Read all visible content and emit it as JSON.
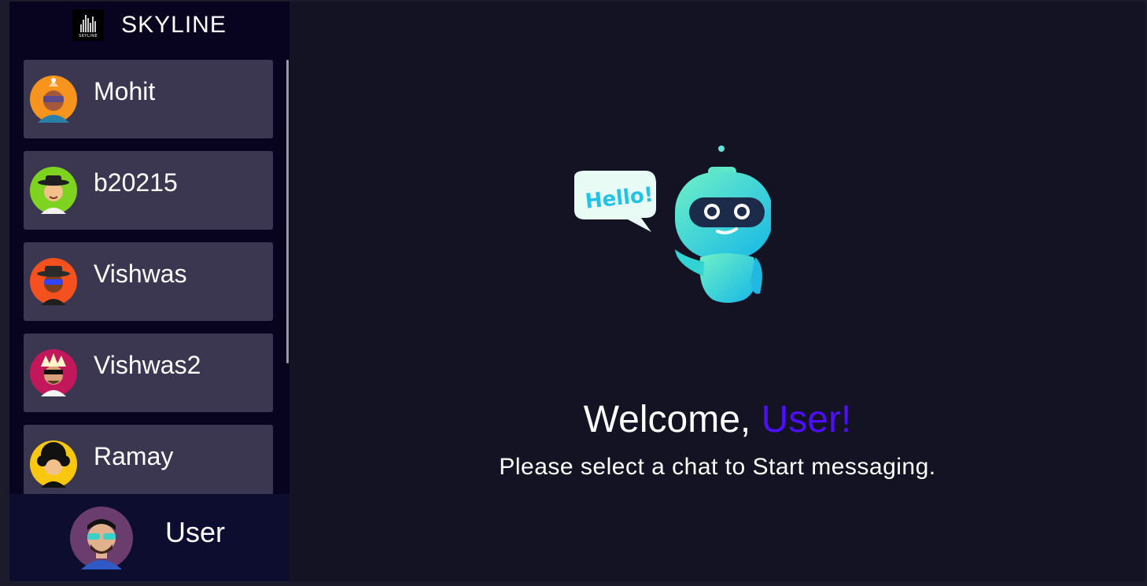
{
  "brand": {
    "name": "SKYLINE",
    "logo_text": "SKYLINE"
  },
  "contacts": [
    {
      "name": "Mohit",
      "avatar_bg": "#f7941d"
    },
    {
      "name": "b20215",
      "avatar_bg": "#7ed321"
    },
    {
      "name": "Vishwas",
      "avatar_bg": "#f4511e"
    },
    {
      "name": "Vishwas2",
      "avatar_bg": "#c2185b"
    },
    {
      "name": "Ramay",
      "avatar_bg": "#f9c80e"
    }
  ],
  "current_user": {
    "name": "User",
    "avatar_bg": "#6a3d6e"
  },
  "welcome": {
    "greeting": "Welcome, ",
    "username": "User!",
    "subtitle": "Please select a chat to Start messaging."
  },
  "robot": {
    "bubble_text": "Hello!"
  },
  "colors": {
    "sidebar_bg": "#080420",
    "main_bg": "#131324",
    "contact_bg": "#3c3751",
    "current_user_bg": "#0d0d30",
    "accent": "#4e0eff"
  }
}
